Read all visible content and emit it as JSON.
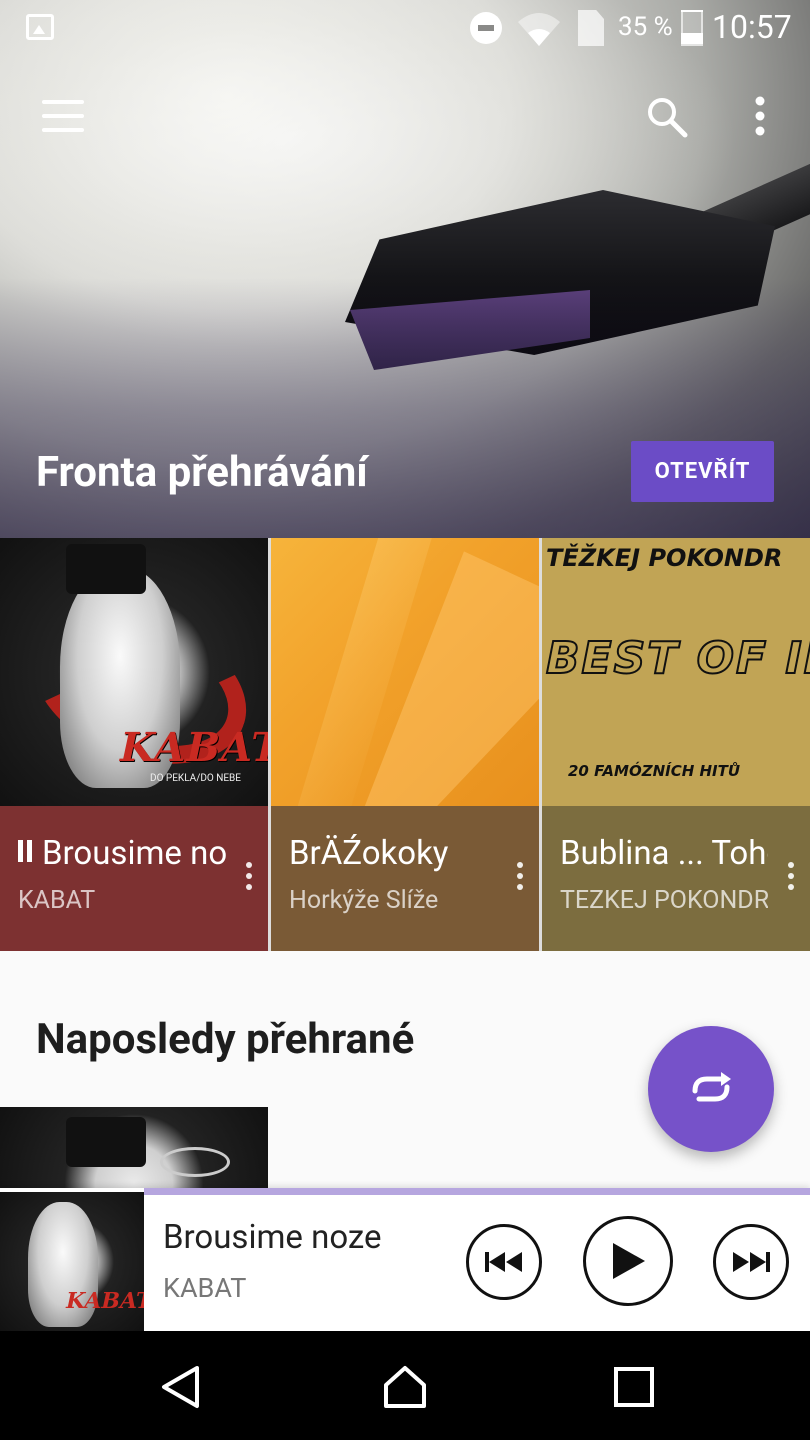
{
  "status_bar": {
    "battery_text": "35 %",
    "time": "10:57"
  },
  "toolbar": {
    "menu_icon": "hamburger-icon",
    "search_icon": "search-icon",
    "overflow_icon": "more-vert-icon"
  },
  "queue": {
    "title": "Fronta přehrávání",
    "open_button": "OTEVŘÍT",
    "cards": [
      {
        "title": "Brousime noze",
        "artist": "KABAT",
        "playing": true,
        "art_text": "KABAT",
        "art_subtext": "DO PEKLA/DO NEBE"
      },
      {
        "title": "BrÄŹokoky",
        "artist": "Horkýže Slíže",
        "playing": false
      },
      {
        "title": "Bublina ... Toho",
        "artist": "TEZKEJ POKONDR",
        "playing": false,
        "art_text_top": "TĚŽKEJ POKONDR",
        "art_text_main": "BEST OF II.",
        "art_text_bottom": "20 FAMÓZNÍCH HITŮ"
      }
    ]
  },
  "recent": {
    "title": "Naposledy přehrané"
  },
  "fab": {
    "icon": "repeat-icon"
  },
  "mini_player": {
    "song": "Brousime noze",
    "artist": "KABAT",
    "progress": 0.0,
    "art_text": "KABAT"
  },
  "colors": {
    "accent": "#6b4cc6",
    "fab": "#7652c9",
    "card1_info": "#7d3131",
    "card2_info": "#7a5a36",
    "card3_info": "#7c6d3f"
  }
}
